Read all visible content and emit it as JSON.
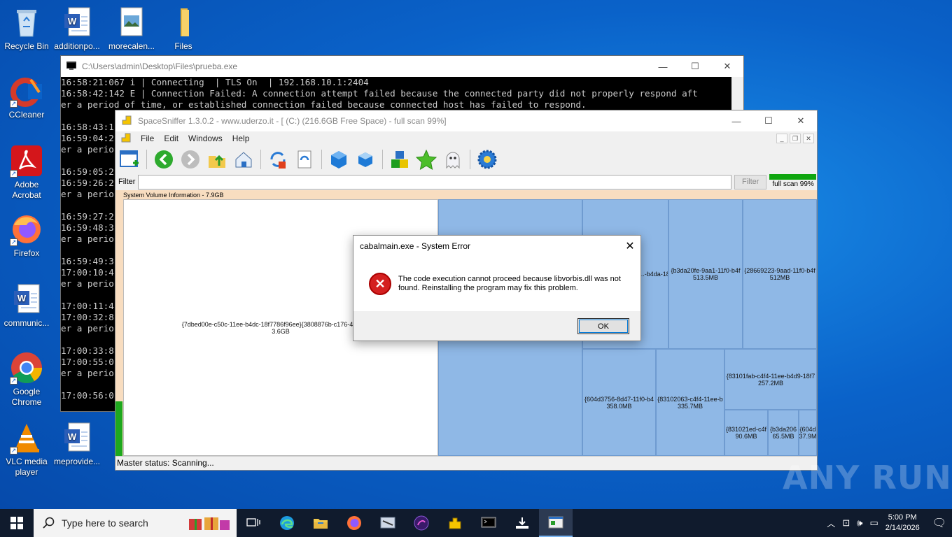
{
  "desktop_icons": [
    {
      "label": "Recycle Bin",
      "icon": "recycle-bin-icon"
    },
    {
      "label": "additionpo...",
      "icon": "word-doc-icon"
    },
    {
      "label": "morecalen...",
      "icon": "image-file-icon"
    },
    {
      "label": "Files",
      "icon": "folder-icon"
    },
    {
      "label": "CCleaner",
      "icon": "ccleaner-icon"
    },
    {
      "label": "Adobe Acrobat",
      "icon": "acrobat-icon"
    },
    {
      "label": "Firefox",
      "icon": "firefox-icon"
    },
    {
      "label": "communic...",
      "icon": "word-doc-icon"
    },
    {
      "label": "Google Chrome",
      "icon": "chrome-icon"
    },
    {
      "label": "VLC media player",
      "icon": "vlc-icon"
    },
    {
      "label": "meprovide...",
      "icon": "word-doc-icon"
    }
  ],
  "console": {
    "title": "C:\\Users\\admin\\Desktop\\Files\\prueba.exe",
    "lines": [
      "16:58:21:067 i | Connecting  | TLS On  | 192.168.10.1:2404",
      "16:58:42:142 E | Connection Failed: A connection attempt failed because the connected party did not properly respond aft",
      "er a period of time, or established connection failed because connected host has failed to respond.",
      "",
      "16:58:43:1",
      "16:59:04:2",
      "er a perio",
      "",
      "16:59:05:2",
      "16:59:26:2",
      "er a perio",
      "",
      "16:59:27:2",
      "16:59:48:3",
      "er a perio",
      "",
      "16:59:49:3",
      "17:00:10:4",
      "er a perio",
      "",
      "17:00:11:4",
      "17:00:32:8",
      "er a perio",
      "",
      "17:00:33:8",
      "17:00:55:0",
      "er a perio",
      "",
      "17:00:56:0"
    ]
  },
  "spacesniffer": {
    "title": "SpaceSniffer 1.3.0.2 - www.uderzo.it - [ (C:) (216.6GB Free Space) - full scan 99%]",
    "menu": [
      "File",
      "Edit",
      "Windows",
      "Help"
    ],
    "filter_label": "Filter",
    "filter_value": "",
    "filter_button": "Filter",
    "scan_label": "full scan 99%",
    "scan_progress": 0.99,
    "treemap_header": "System Volume Information - 7.9GB",
    "status": "Master status: Scanning...",
    "cells": [
      {
        "name": "{7dbed00e-c50c-11ee-b4dc-18f7786f96ee}{3808876b-c176-4e48-b7ae",
        "size": "3.6GB"
      },
      {
        "name": "{...-b4da-18",
        "size": ""
      },
      {
        "name": "{b3da20fe-9aa1-11f0-b4f",
        "size": "513.5MB"
      },
      {
        "name": "{28669223-9aad-11f0-b4f",
        "size": "512MB"
      },
      {
        "name": "{604d3756-8d47-11f0-b4",
        "size": "358.0MB"
      },
      {
        "name": "{83102063-c4f4-11ee-b",
        "size": "335.7MB"
      },
      {
        "name": "{83101fab-c4f4-11ee-b4d9-18f7",
        "size": "257.2MB"
      },
      {
        "name": "{831021ed-c4f",
        "size": "90.6MB"
      },
      {
        "name": "{b3da206",
        "size": "65.5MB"
      },
      {
        "name": "{604d",
        "size": "37.9M"
      }
    ]
  },
  "dialog": {
    "title": "cabalmain.exe - System Error",
    "message": "The code execution cannot proceed because libvorbis.dll was not found. Reinstalling the program may fix this problem.",
    "ok_label": "OK"
  },
  "taskbar": {
    "search_placeholder": "Type here to search",
    "time": "5:00 PM",
    "date": "2/14/2026"
  },
  "watermark": "ANY RUN"
}
